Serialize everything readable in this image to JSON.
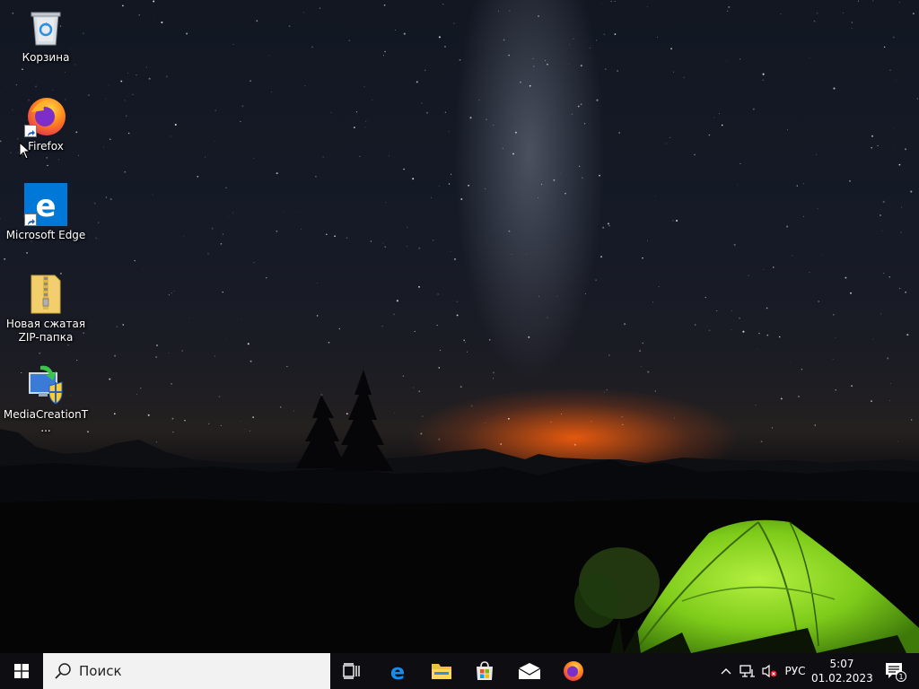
{
  "desktop_icons": [
    {
      "label": "Корзина",
      "icon": "recycle-bin-icon"
    },
    {
      "label": "Firefox",
      "icon": "firefox-icon"
    },
    {
      "label": "Microsoft Edge",
      "icon": "edge-icon"
    },
    {
      "label": "Новая сжатая ZIP-папка",
      "icon": "zip-folder-icon"
    },
    {
      "label": "MediaCreationT...",
      "icon": "media-creation-tool-icon"
    }
  ],
  "taskbar": {
    "search_placeholder": "Поиск",
    "pinned": [
      "task-view-icon",
      "edge-icon",
      "file-explorer-icon",
      "store-icon",
      "mail-icon",
      "firefox-icon"
    ],
    "tray": {
      "language": "РУС",
      "time": "5:07",
      "date": "01.02.2023",
      "notification_count": "1"
    }
  },
  "colors": {
    "taskbar_bg": "#0e0e12",
    "search_bg": "#f2f2f2",
    "tent_green": "#7ecb1a",
    "horizon_glow": "#ff6a10"
  }
}
